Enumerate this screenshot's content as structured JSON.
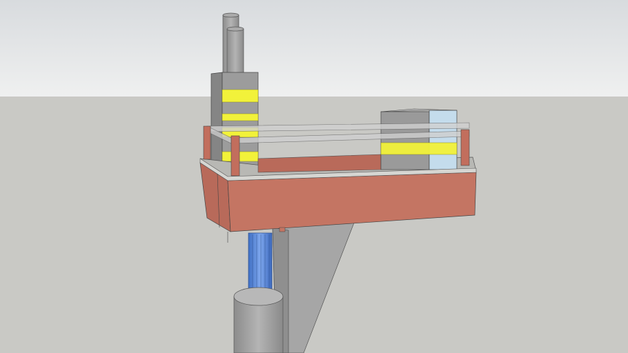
{
  "scene": {
    "type": "3d-model-render",
    "colors": {
      "sky_top": "#d8dbde",
      "sky_bottom": "#eff0f0",
      "ground": "#c9c9c5",
      "concrete": "#a4a4a4",
      "brick": "#c0705f",
      "glass_yellow": "#f2f23a",
      "glass_blue": "#b9d3e6",
      "pipe_blue": "#4f86d9"
    }
  }
}
